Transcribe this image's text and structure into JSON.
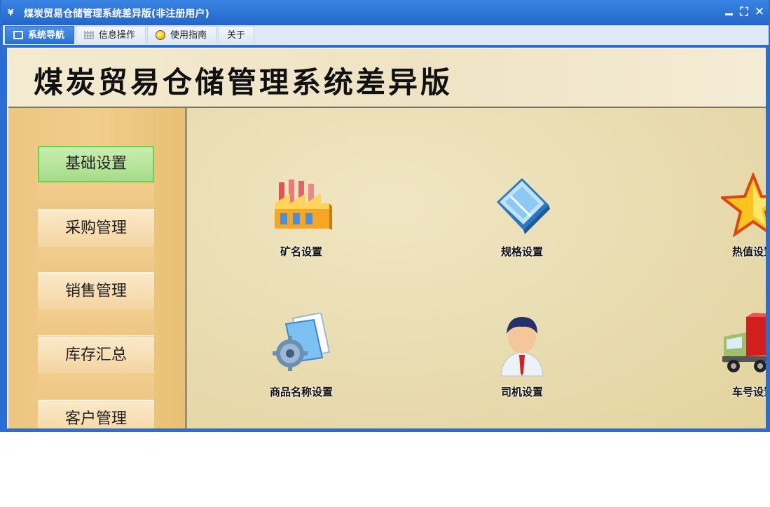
{
  "window": {
    "title": "煤炭贸易仓储管理系统差异版(非注册用户)",
    "icon": "app-logo-icon",
    "controls": [
      "minimize-icon",
      "restore-icon",
      "close-icon"
    ]
  },
  "menu": {
    "tabs": [
      {
        "label": "系统导航",
        "icon": "monitor-icon",
        "active": true
      },
      {
        "label": "信息操作",
        "icon": "grid-icon",
        "active": false
      },
      {
        "label": "使用指南",
        "icon": "bulb-icon",
        "active": false
      },
      {
        "label": "关于",
        "icon": "",
        "active": false
      }
    ]
  },
  "banner": {
    "title": "煤炭贸易仓储管理系统差异版"
  },
  "sidebar": {
    "items": [
      {
        "label": "基础设置",
        "active": true
      },
      {
        "label": "采购管理",
        "active": false
      },
      {
        "label": "销售管理",
        "active": false
      },
      {
        "label": "库存汇总",
        "active": false
      },
      {
        "label": "客户管理",
        "active": false
      }
    ]
  },
  "tiles": [
    {
      "label": "矿名设置",
      "icon": "factory-icon"
    },
    {
      "label": "规格设置",
      "icon": "book-icon"
    },
    {
      "label": "热值设置",
      "icon": "star-icon"
    },
    {
      "label": "商品名称设置",
      "icon": "document-gear-icon"
    },
    {
      "label": "司机设置",
      "icon": "person-icon"
    },
    {
      "label": "车号设置",
      "icon": "truck-icon"
    }
  ],
  "colors": {
    "titlebar": "#2a6fd0",
    "active_nav": "#a6dc8a",
    "sidebar": "#ecc580"
  }
}
